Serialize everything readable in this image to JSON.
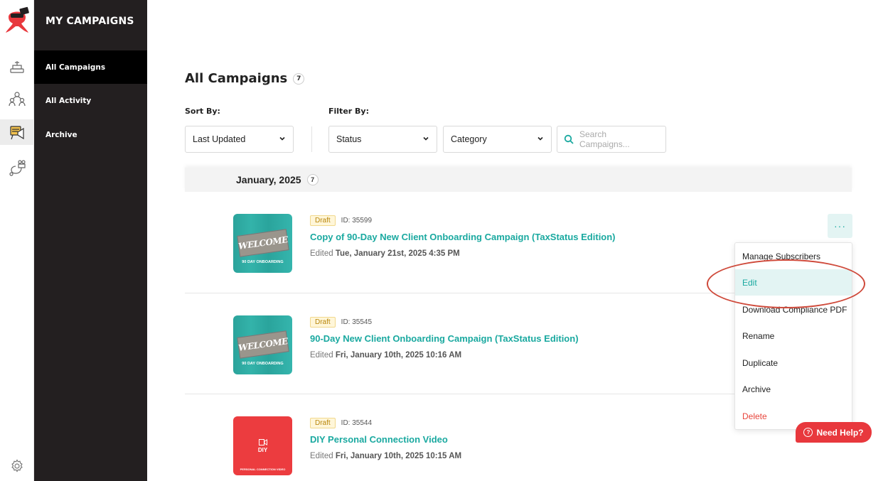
{
  "sidebar": {
    "title": "MY CAMPAIGNS",
    "items": [
      {
        "label": "All Campaigns"
      },
      {
        "label": "All Activity"
      },
      {
        "label": "Archive"
      }
    ]
  },
  "rail": {
    "icons": [
      "brand-logo-icon",
      "dashboard-icon",
      "contacts-icon",
      "campaigns-icon",
      "automation-icon",
      "settings-icon"
    ]
  },
  "page": {
    "title": "All Campaigns",
    "count": "7"
  },
  "sort": {
    "label": "Sort By:",
    "value": "Last Updated"
  },
  "filter": {
    "label": "Filter By:",
    "status": "Status",
    "category": "Category",
    "search_placeholder": "Search Campaigns..."
  },
  "group": {
    "label": "January, 2025",
    "count": "7"
  },
  "campaigns": [
    {
      "status": "Draft",
      "id": "ID: 35599",
      "name": "Copy of 90-Day New Client Onboarding Campaign (TaxStatus Edition)",
      "edited_prefix": "Edited",
      "edited_date": "Tue, January 21st, 2025 4:35 PM",
      "thumb_title": "WELCOME",
      "thumb_sub": "90 DAY ONBOARDING"
    },
    {
      "status": "Draft",
      "id": "ID: 35545",
      "name": "90-Day New Client Onboarding Campaign (TaxStatus Edition)",
      "edited_prefix": "Edited",
      "edited_date": "Fri, January 10th, 2025 10:16 AM",
      "thumb_title": "WELCOME",
      "thumb_sub": "90 DAY ONBOARDING"
    },
    {
      "status": "Draft",
      "id": "ID: 35544",
      "name": "DIY Personal Connection Video",
      "edited_prefix": "Edited",
      "edited_date": "Fri, January 10th, 2025 10:15 AM",
      "thumb_title": "DIY",
      "thumb_sub": "PERSONAL CONNECTION VIDEO"
    }
  ],
  "more_button": "···",
  "menu": {
    "items": [
      {
        "label": "Manage Subscribers"
      },
      {
        "label": "Edit"
      },
      {
        "label": "Download Compliance PDF"
      },
      {
        "label": "Rename"
      },
      {
        "label": "Duplicate"
      },
      {
        "label": "Archive"
      },
      {
        "label": "Delete"
      }
    ]
  },
  "help": {
    "label": "Need Help?",
    "icon": "?"
  },
  "colors": {
    "accent": "#1aa9a0",
    "sidebar": "#231f20",
    "danger": "#e8453c",
    "help": "#e8383d",
    "annotation": "#cf4a3b"
  }
}
